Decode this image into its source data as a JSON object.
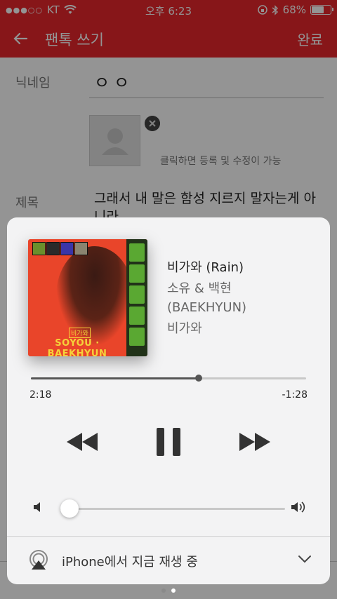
{
  "status_bar": {
    "carrier": "KT",
    "time": "오후 6:23",
    "battery": "68%",
    "battery_level": 0.68
  },
  "app": {
    "nav_title": "팬톡 쓰기",
    "done_label": "완료",
    "nickname_label": "닉네임",
    "nickname_value": "ㅇㅇ",
    "photo_hint": "클릭하면 등록 및 수정이 가능",
    "title_label": "제목",
    "title_value": "그래서 내 말은 함성 지르지 말자는게 아니라"
  },
  "now_playing": {
    "song": "비가와 (Rain)",
    "artist": "소유 & 백현 (BAEKHYUN)",
    "album": "비가와",
    "album_art_tag": "비가와",
    "album_art_text": "SOYOU · BAEKHYUN",
    "elapsed": "2:18",
    "remaining": "-1:28",
    "progress": 0.61,
    "volume": 0.04,
    "route_text": "iPhone에서 지금 재생 중"
  },
  "pager": {
    "count": 2,
    "active": 1
  },
  "colors": {
    "app_accent": "#e8262c",
    "card_bg": "#f3f3f4",
    "track_played": "#555555",
    "track_empty": "#c8c8c8"
  }
}
